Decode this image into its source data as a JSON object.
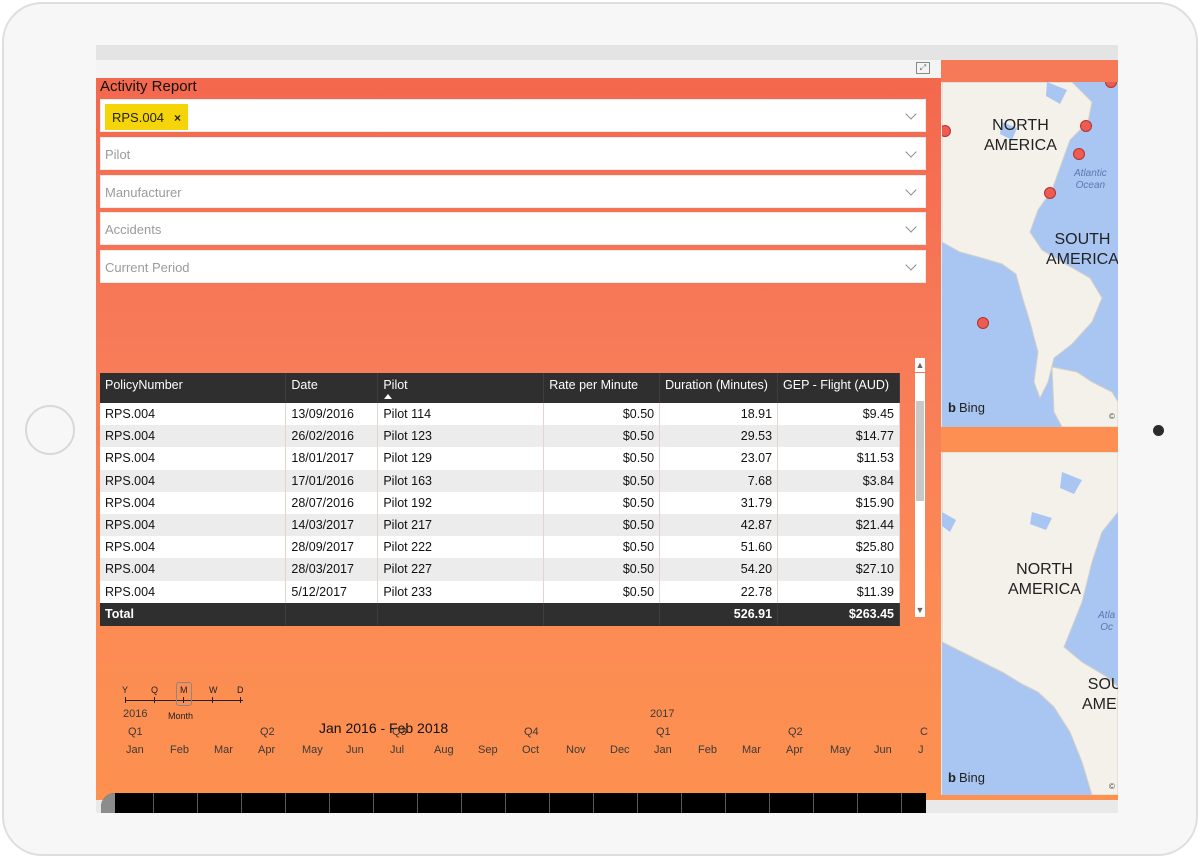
{
  "report": {
    "title": "Activity Report"
  },
  "slicers": [
    {
      "selected": "RPS.004",
      "remove_glyph": "×",
      "placeholder": ""
    },
    {
      "selected": "",
      "placeholder": "Pilot"
    },
    {
      "selected": "",
      "placeholder": "Manufacturer"
    },
    {
      "selected": "",
      "placeholder": "Accidents"
    },
    {
      "selected": "",
      "placeholder": "Current Period"
    }
  ],
  "table": {
    "columns": [
      "PolicyNumber",
      "Date",
      "Pilot",
      "Rate per Minute",
      "Duration (Minutes)",
      "GEP - Flight (AUD)"
    ],
    "sorted_column": "Pilot",
    "rows": [
      [
        "RPS.004",
        "13/09/2016",
        "Pilot 114",
        "$0.50",
        "18.91",
        "$9.45"
      ],
      [
        "RPS.004",
        "26/02/2016",
        "Pilot 123",
        "$0.50",
        "29.53",
        "$14.77"
      ],
      [
        "RPS.004",
        "18/01/2017",
        "Pilot 129",
        "$0.50",
        "23.07",
        "$11.53"
      ],
      [
        "RPS.004",
        "17/01/2016",
        "Pilot 163",
        "$0.50",
        "7.68",
        "$3.84"
      ],
      [
        "RPS.004",
        "28/07/2016",
        "Pilot 192",
        "$0.50",
        "31.79",
        "$15.90"
      ],
      [
        "RPS.004",
        "14/03/2017",
        "Pilot 217",
        "$0.50",
        "42.87",
        "$21.44"
      ],
      [
        "RPS.004",
        "28/09/2017",
        "Pilot 222",
        "$0.50",
        "51.60",
        "$25.80"
      ],
      [
        "RPS.004",
        "28/03/2017",
        "Pilot 227",
        "$0.50",
        "54.20",
        "$27.10"
      ],
      [
        "RPS.004",
        "5/12/2017",
        "Pilot 233",
        "$0.50",
        "22.78",
        "$11.39"
      ]
    ],
    "total": {
      "label": "Total",
      "duration": "526.91",
      "gep": "$263.45"
    }
  },
  "timeline": {
    "granularity_options": [
      "Y",
      "Q",
      "M",
      "W",
      "D"
    ],
    "granularity_selected": "Month",
    "range_label": "Jan 2016 - Feb 2018",
    "years": [
      "2016",
      "2017"
    ],
    "quarters": [
      "Q1",
      "Q2",
      "Q3",
      "Q4",
      "Q1",
      "Q2",
      "C"
    ],
    "months": [
      "Jan",
      "Feb",
      "Mar",
      "Apr",
      "May",
      "Jun",
      "Jul",
      "Aug",
      "Sep",
      "Oct",
      "Nov",
      "Dec",
      "Jan",
      "Feb",
      "Mar",
      "Apr",
      "May",
      "Jun",
      "J"
    ]
  },
  "maps": {
    "map1": {
      "label_na": "NORTH\nAMERICA",
      "label_sa": "SOUTH\nAMERICA",
      "ocean": "Atlantic\nOcean",
      "provider": "Bing",
      "copyright": "©"
    },
    "map2": {
      "label_na": "NORTH\nAMERICA",
      "label_sa": "SOU\nAMER",
      "ocean": "Atla\nOc",
      "provider": "Bing",
      "copyright": "©"
    }
  },
  "colors": {
    "slicer_chip": "#f5d40a",
    "header_bg": "#2f2f2f",
    "map_water": "#a9c6f2",
    "map_dot": "#ee5b52",
    "report_gradient_top": "#f4684e",
    "report_gradient_bottom": "#fd914f"
  },
  "icons": {
    "focus": "focus-mode-icon",
    "dropdown": "chevron-down-icon",
    "remove": "close-icon",
    "bing": "bing-logo-icon"
  }
}
